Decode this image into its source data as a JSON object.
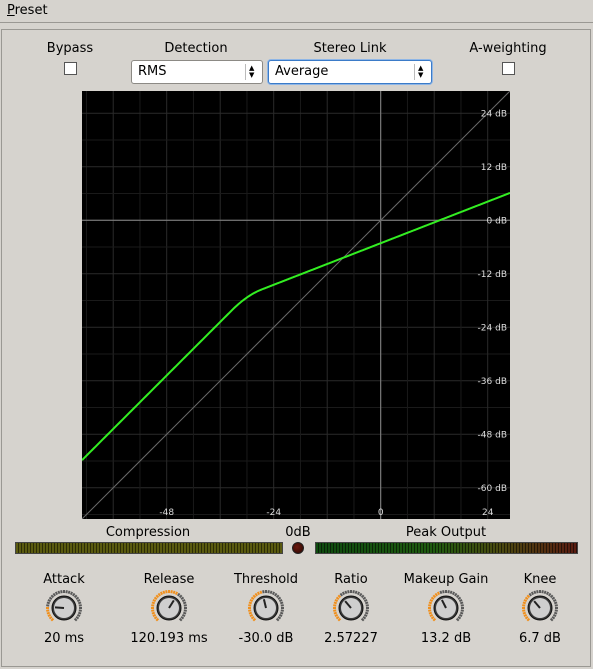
{
  "menu": {
    "preset": "Preset"
  },
  "controls": {
    "bypass": {
      "label": "Bypass",
      "checked": false
    },
    "detection": {
      "label": "Detection",
      "value": "RMS"
    },
    "stereo_link": {
      "label": "Stereo Link",
      "value": "Average"
    },
    "a_weighting": {
      "label": "A-weighting",
      "checked": false
    }
  },
  "graph": {
    "curve_color": "#33ee22",
    "y_ticks": [
      "24 dB",
      "12 dB",
      "0 dB",
      "-12 dB",
      "-24 dB",
      "-36 dB",
      "-48 dB",
      "-60 dB"
    ],
    "x_ticks": [
      "-48",
      "-24",
      "0",
      "24"
    ],
    "x_tick_values": [
      -48,
      -24,
      0,
      24
    ],
    "y_tick_values": [
      24,
      12,
      0,
      -12,
      -24,
      -36,
      -48,
      -60
    ],
    "x_range": [
      -67,
      29
    ],
    "y_range": [
      -67,
      29
    ],
    "threshold_db": -30.0,
    "ratio": 2.57227,
    "makeup_db": 13.2,
    "knee_db": 6.7
  },
  "meters": {
    "compression": "Compression",
    "clip": "0dB",
    "peak_output": "Peak Output"
  },
  "knobs": [
    {
      "name": "attack",
      "label": "Attack",
      "value": "20 ms",
      "level": 0.18
    },
    {
      "name": "release",
      "label": "Release",
      "value": "120.193 ms",
      "level": 0.62
    },
    {
      "name": "threshold",
      "label": "Threshold",
      "value": "-30.0 dB",
      "level": 0.45
    },
    {
      "name": "ratio",
      "label": "Ratio",
      "value": "2.57227",
      "level": 0.35
    },
    {
      "name": "makeup-gain",
      "label": "Makeup Gain",
      "value": "13.2 dB",
      "level": 0.4
    },
    {
      "name": "knee",
      "label": "Knee",
      "value": "6.7 dB",
      "level": 0.35
    }
  ]
}
